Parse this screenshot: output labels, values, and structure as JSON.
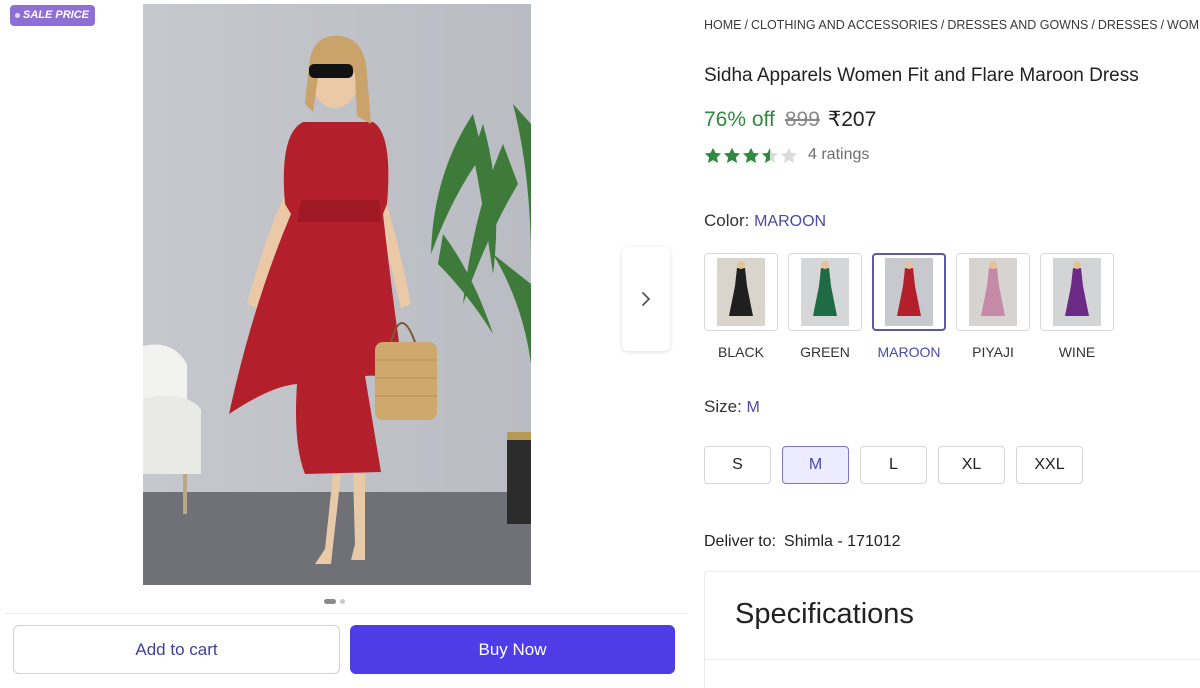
{
  "badge": {
    "label": "SALE PRICE"
  },
  "gallery": {
    "image_alt": "Woman wearing maroon fit and flare midi dress"
  },
  "breadcrumb": [
    "HOME",
    "CLOTHING AND ACCESSORIES",
    "DRESSES AND GOWNS",
    "DRESSES",
    "WOMEN'S"
  ],
  "product": {
    "title": "Sidha Apparels Women Fit and Flare Maroon Dress",
    "discount": "76% off",
    "mrp": "899",
    "price": "₹207",
    "rating_value": 3.5,
    "ratings_text": "4 ratings"
  },
  "color": {
    "label": "Color:",
    "selected": "MAROON",
    "options": [
      {
        "name": "BLACK",
        "hex": "#1f1f1f"
      },
      {
        "name": "GREEN",
        "hex": "#1e6b45"
      },
      {
        "name": "MAROON",
        "hex": "#b3202b"
      },
      {
        "name": "PIYAJI",
        "hex": "#c48aa6"
      },
      {
        "name": "WINE",
        "hex": "#6b2a86"
      }
    ]
  },
  "size": {
    "label": "Size:",
    "selected": "M",
    "options": [
      "S",
      "M",
      "L",
      "XL",
      "XXL"
    ]
  },
  "delivery": {
    "label": "Deliver to:",
    "location": "Shimla - 171012"
  },
  "specifications": {
    "title": "Specifications"
  },
  "actions": {
    "add_to_cart": "Add to cart",
    "buy_now": "Buy Now"
  },
  "colors": {
    "accent": "#4e3ce6",
    "discount": "#2e8b3d",
    "badge": "#8e6fd6",
    "star": "#2e8b3d"
  }
}
